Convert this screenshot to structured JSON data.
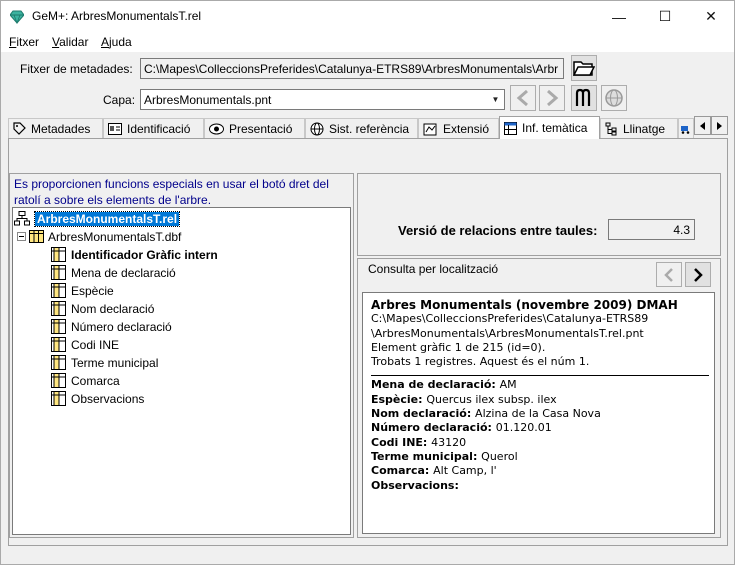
{
  "window": {
    "title": "GeM+: ArbresMonumentalsT.rel",
    "controls": {
      "minimize": "—",
      "maximize": "☐",
      "close": "✕"
    }
  },
  "menu": [
    {
      "label_rest": "itxer",
      "accel": "F"
    },
    {
      "label_rest": "alidar",
      "accel": "V"
    },
    {
      "label_rest": "juda",
      "accel": "A"
    }
  ],
  "metadata_file": {
    "label": "Fitxer de metadades:",
    "value": "C:\\Mapes\\ColleccionsPreferides\\Catalunya-ETRS89\\ArbresMonumentals\\Arbr"
  },
  "layer": {
    "label": "Capa:",
    "value": "ArbresMonumentals.pnt"
  },
  "toolbar_icons": [
    "folder-open-icon",
    "back-arrow-icon",
    "forward-arrow-icon",
    "m-symbol-icon",
    "globe-icon"
  ],
  "tabs": [
    {
      "label": "Metadades",
      "icon": "tag-icon"
    },
    {
      "label": "Identificació",
      "icon": "id-card-icon"
    },
    {
      "label": "Presentació",
      "icon": "eye-icon"
    },
    {
      "label": "Sist. referència",
      "icon": "globe-icon"
    },
    {
      "label": "Extensió",
      "icon": "map-extent-icon"
    },
    {
      "label": "Inf. temàtica",
      "icon": "table-icon",
      "active": true
    },
    {
      "label": "Llinatge",
      "icon": "lineage-icon"
    }
  ],
  "left_panel": {
    "hint": "Es proporcionen funcions especials en usar el botó dret del ratolí a sobre els elements de l'arbre.",
    "tree": {
      "root": "ArbresMonumentalsT.rel",
      "table": "ArbresMonumentalsT.dbf",
      "fields": [
        {
          "label": "Identificador Gràfic intern",
          "bold": true
        },
        {
          "label": "Mena de declaració"
        },
        {
          "label": "Espècie"
        },
        {
          "label": "Nom declaració"
        },
        {
          "label": "Número declaració"
        },
        {
          "label": "Codi INE"
        },
        {
          "label": "Terme municipal"
        },
        {
          "label": "Comarca"
        },
        {
          "label": "Observacions"
        }
      ]
    }
  },
  "right_panel": {
    "version_label": "Versió de relacions entre taules:",
    "version_value": "4.3",
    "query_label": "Consulta per localització",
    "record": {
      "title": "Arbres Monumentals (novembre 2009) DMAH",
      "path_line1": "C:\\Mapes\\ColleccionsPreferides\\Catalunya-ETRS89",
      "path_line2": "\\ArbresMonumentals\\ArbresMonumentalsT.rel.pnt",
      "element_line": "Element gràfic 1 de 215 (id=0).",
      "found_line": "Trobats 1 registres. Aquest és el núm 1.",
      "fields": [
        {
          "key": "Mena de declaració",
          "value": "AM"
        },
        {
          "key": "Espècie",
          "value": "Quercus ilex subsp. ilex"
        },
        {
          "key": "Nom declaració",
          "value": "Alzina de la Casa Nova"
        },
        {
          "key": "Número declaració",
          "value": "01.120.01"
        },
        {
          "key": "Codi INE",
          "value": "43120"
        },
        {
          "key": "Terme municipal",
          "value": "Querol"
        },
        {
          "key": "Comarca",
          "value": "Alt Camp, l'"
        },
        {
          "key": "Observacions",
          "value": ""
        }
      ]
    }
  },
  "colors": {
    "selection": "#0078d7",
    "hint_text": "#00008b",
    "window_bg": "#f0f0f0"
  }
}
